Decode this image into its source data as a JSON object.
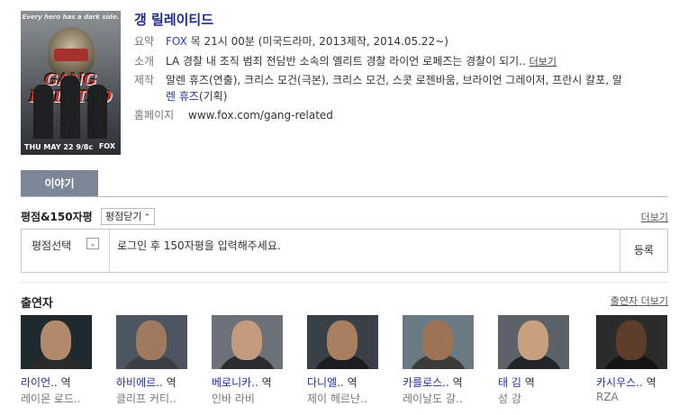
{
  "show": {
    "title": "갱 릴레이티드",
    "poster": {
      "tagline": "Every hero has a dark side.",
      "logo_text": "GANG RELATED",
      "date_text": "THU MAY 22 9/8c",
      "network": "FOX"
    },
    "summary_label": "요약",
    "summary_network": "FOX",
    "summary_rest": " 목 21시 00분 (미국드라마, 2013제작, 2014.05.22~)",
    "synopsis_label": "소개",
    "synopsis": "LA 경찰 내 조직 범죄 전담반 소속의 엘리트 경찰 라이언 로페즈는 경찰이 되기..",
    "synopsis_more": "더보기",
    "production_label": "제작",
    "production_line1": "알렌 휴즈(연출), 크리스 모건(극본), 크리스 모건, 스콧 로젠바움, 브라이언 그레이저, 프란시 칼포, 알",
    "production_line2_name": "렌 휴즈",
    "production_line2_role": "(기획)",
    "homepage_label": "홈페이지",
    "homepage_url": "www.fox.com/gang-related"
  },
  "tabs": [
    {
      "label": "이야기"
    }
  ],
  "ratings": {
    "title": "평점&150자평",
    "sort_label": "평점닫기",
    "more_label": "더보기",
    "select_label": "평점선택",
    "input_placeholder": "로그인 후 150자평을 입력해주세요.",
    "submit_label": "등록"
  },
  "cast_section": {
    "title": "출연자",
    "more_label": "출연자 더보기",
    "members": [
      {
        "character": "라이언..",
        "role": " 역",
        "actor": "레이몬 로드..",
        "skin": "#b08a6a",
        "bg": "#1f2a2f",
        "shirt": "#2a2a2a"
      },
      {
        "character": "하비에르..",
        "role": " 역",
        "actor": "클리프 커티..",
        "skin": "#a07a5e",
        "bg": "#4d5660",
        "shirt": "#3a3f46"
      },
      {
        "character": "베로니카..",
        "role": " 역",
        "actor": "인바 라비",
        "skin": "#c49b7c",
        "bg": "#6c7277",
        "shirt": "#2c2c30"
      },
      {
        "character": "다니엘..",
        "role": " 역",
        "actor": "제이 헤르난..",
        "skin": "#a8805f",
        "bg": "#3a4048",
        "shirt": "#1e1e22"
      },
      {
        "character": "카를로스..",
        "role": " 역",
        "actor": "레이날도 갈..",
        "skin": "#9c7454",
        "bg": "#6a7a83",
        "shirt": "#3b3b3b"
      },
      {
        "character": "태 김",
        "role": " 역",
        "actor": "성 강",
        "skin": "#c9a07e",
        "bg": "#5b6268",
        "shirt": "#22252a"
      },
      {
        "character": "카시우스..",
        "role": " 역",
        "actor": "RZA",
        "skin": "#5e3d2a",
        "bg": "#2b2b2b",
        "shirt": "#151515"
      }
    ]
  }
}
